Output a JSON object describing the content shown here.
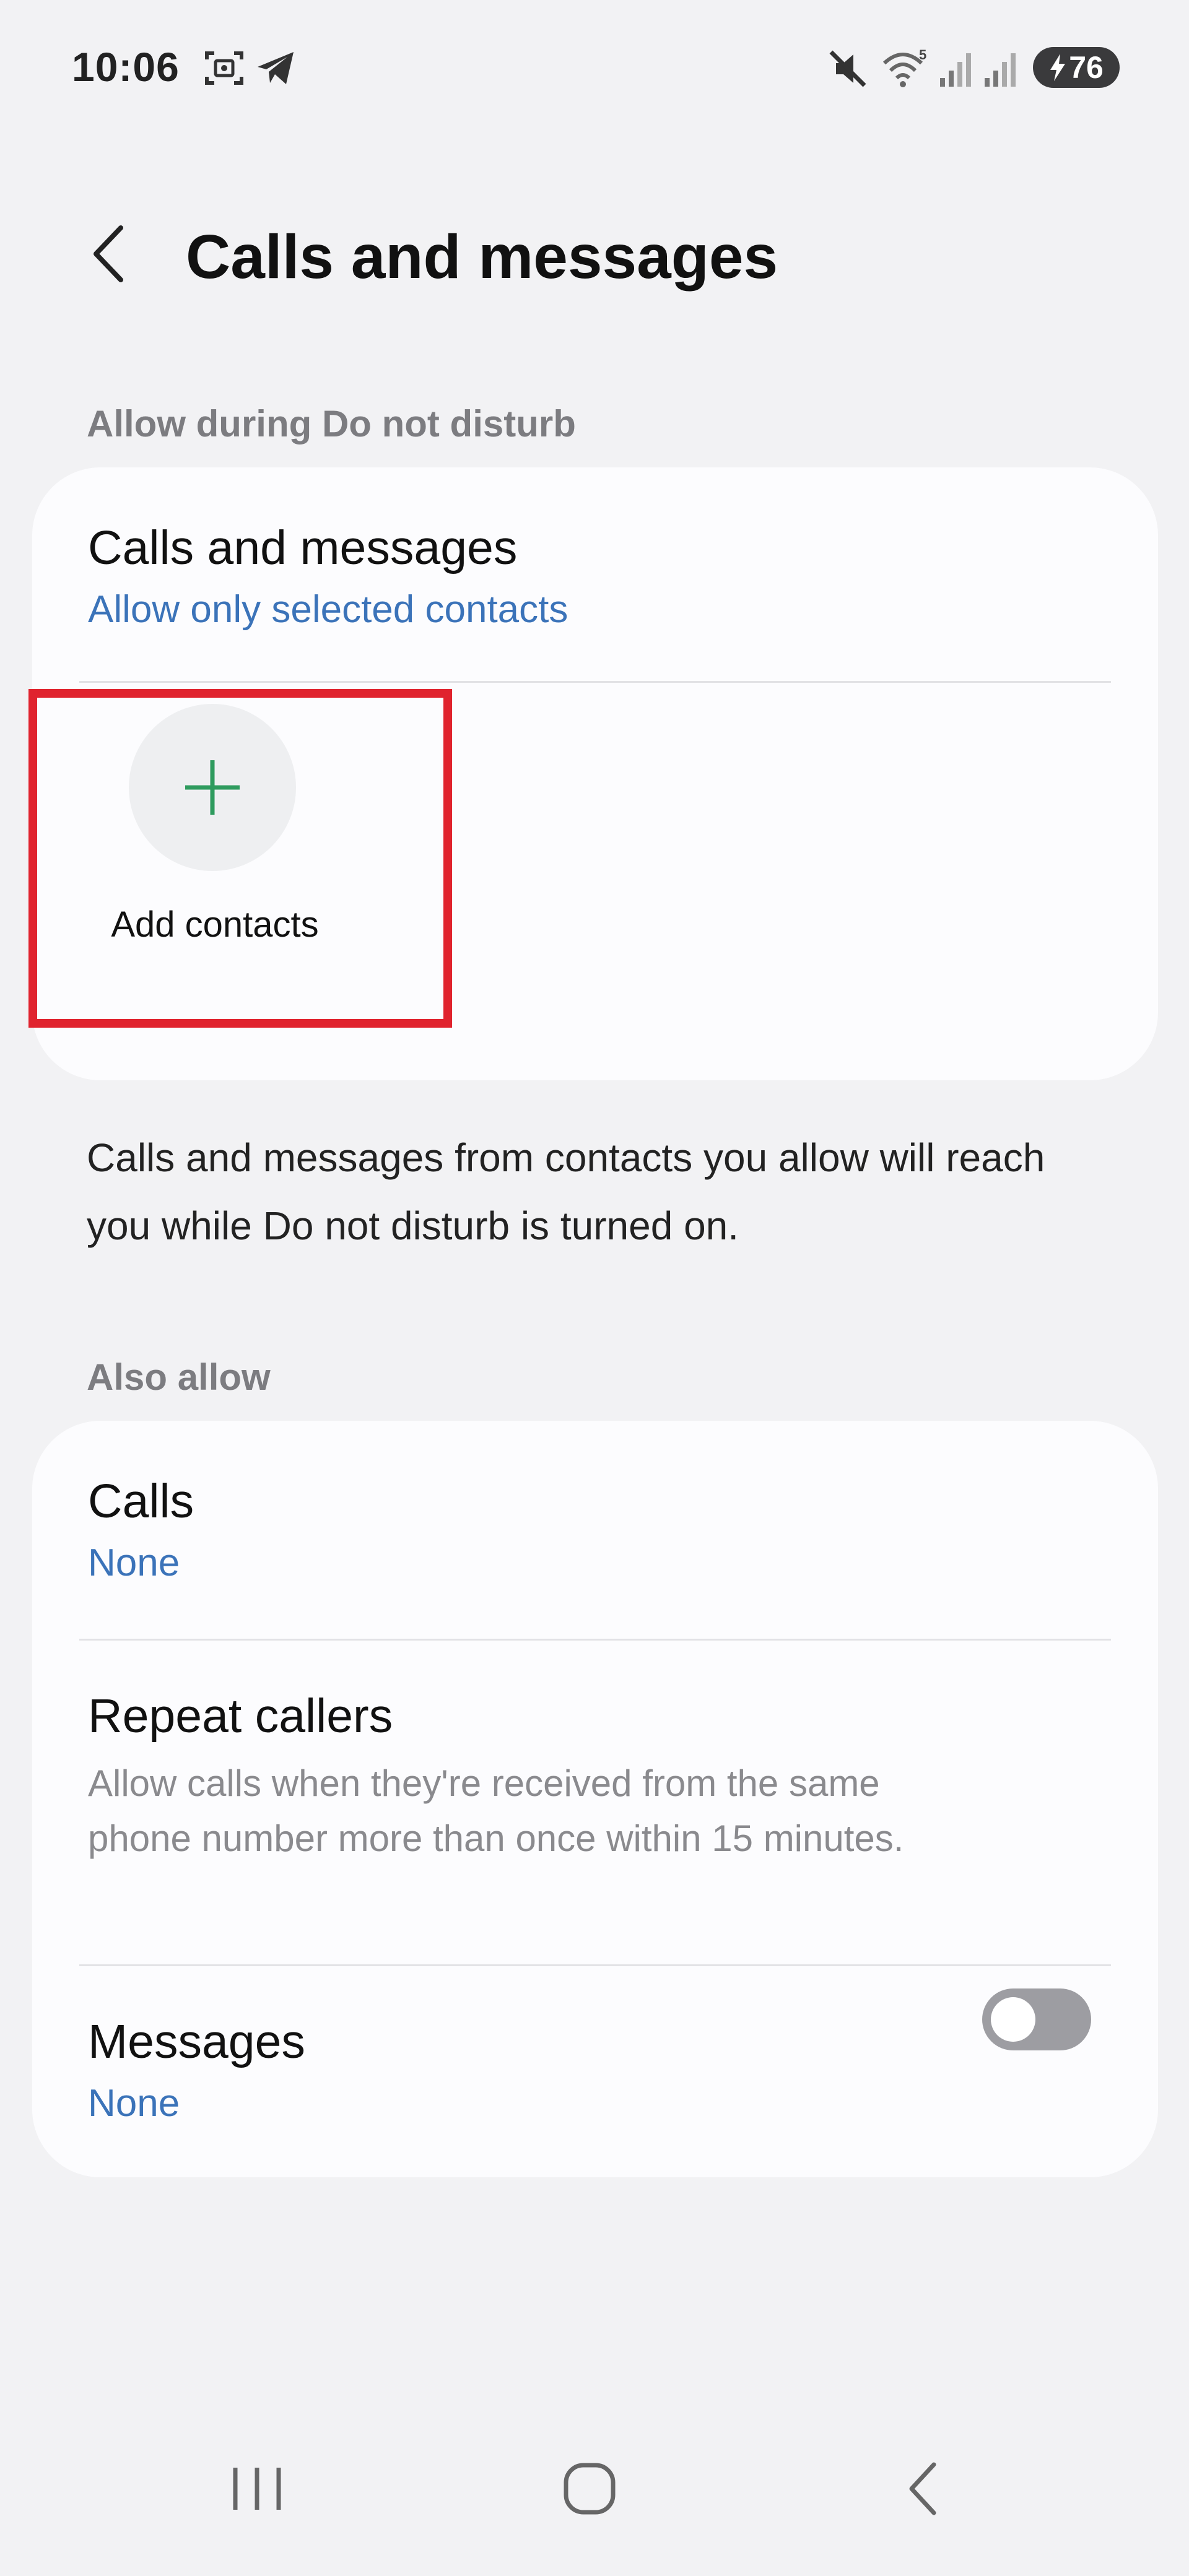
{
  "status_bar": {
    "time": "10:06",
    "battery_level": "76",
    "icons": [
      "screenshot-icon",
      "telegram-icon",
      "mute-icon",
      "wifi-icon",
      "signal-icon",
      "signal-icon",
      "charging-icon"
    ]
  },
  "header": {
    "back_icon": "chevron-left-icon",
    "title": "Calls and messages"
  },
  "section_allow": {
    "header": "Allow during Do not disturb",
    "calls_messages": {
      "title": "Calls and messages",
      "value": "Allow only selected contacts"
    },
    "add_contacts": {
      "icon": "plus-icon",
      "label": "Add contacts"
    }
  },
  "info_text": "Calls and messages from contacts you allow will reach you while Do not disturb is turned on.",
  "section_also": {
    "header": "Also allow",
    "calls": {
      "title": "Calls",
      "value": "None"
    },
    "repeat_callers": {
      "title": "Repeat callers",
      "description": "Allow calls when they're received from the same phone number more than once within 15 minutes.",
      "toggle_on": false
    },
    "messages": {
      "title": "Messages",
      "value": "None"
    }
  },
  "nav_bar": {
    "icons": [
      "recents-icon",
      "home-icon",
      "back-icon"
    ]
  },
  "colors": {
    "background": "#f2f2f4",
    "card": "#fcfcfe",
    "accent_blue": "#3b73b9",
    "plus_green": "#2e9b5e",
    "highlight_red": "#e0232e",
    "toggle_off": "#9d9da2"
  }
}
